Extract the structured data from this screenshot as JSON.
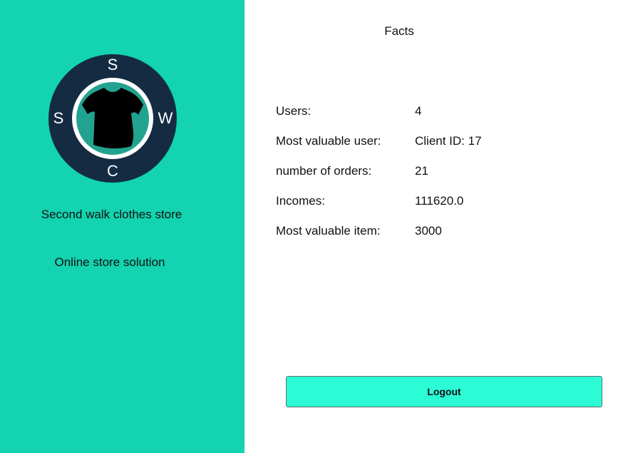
{
  "sidebar": {
    "logo": {
      "letters": {
        "top": "S",
        "left": "S",
        "right": "W",
        "bottom": "C"
      },
      "colors": {
        "ring": "#142b42",
        "inner_border": "#ffffff",
        "inner_fill": "#22a38f",
        "shirt": "#000000"
      }
    },
    "store_name": "Second walk clothes store",
    "tagline": "Online store solution",
    "background": "#13d3b0"
  },
  "main": {
    "title": "Facts",
    "facts": [
      {
        "label": "Users:",
        "value": "4"
      },
      {
        "label": "Most valuable user:",
        "value": "Client ID: 17"
      },
      {
        "label": "number of orders:",
        "value": "21"
      },
      {
        "label": "Incomes:",
        "value": "111620.0"
      },
      {
        "label": "Most valuable item:",
        "value": "3000"
      }
    ],
    "logout_label": "Logout",
    "logout_color": "#2bfcd6"
  }
}
